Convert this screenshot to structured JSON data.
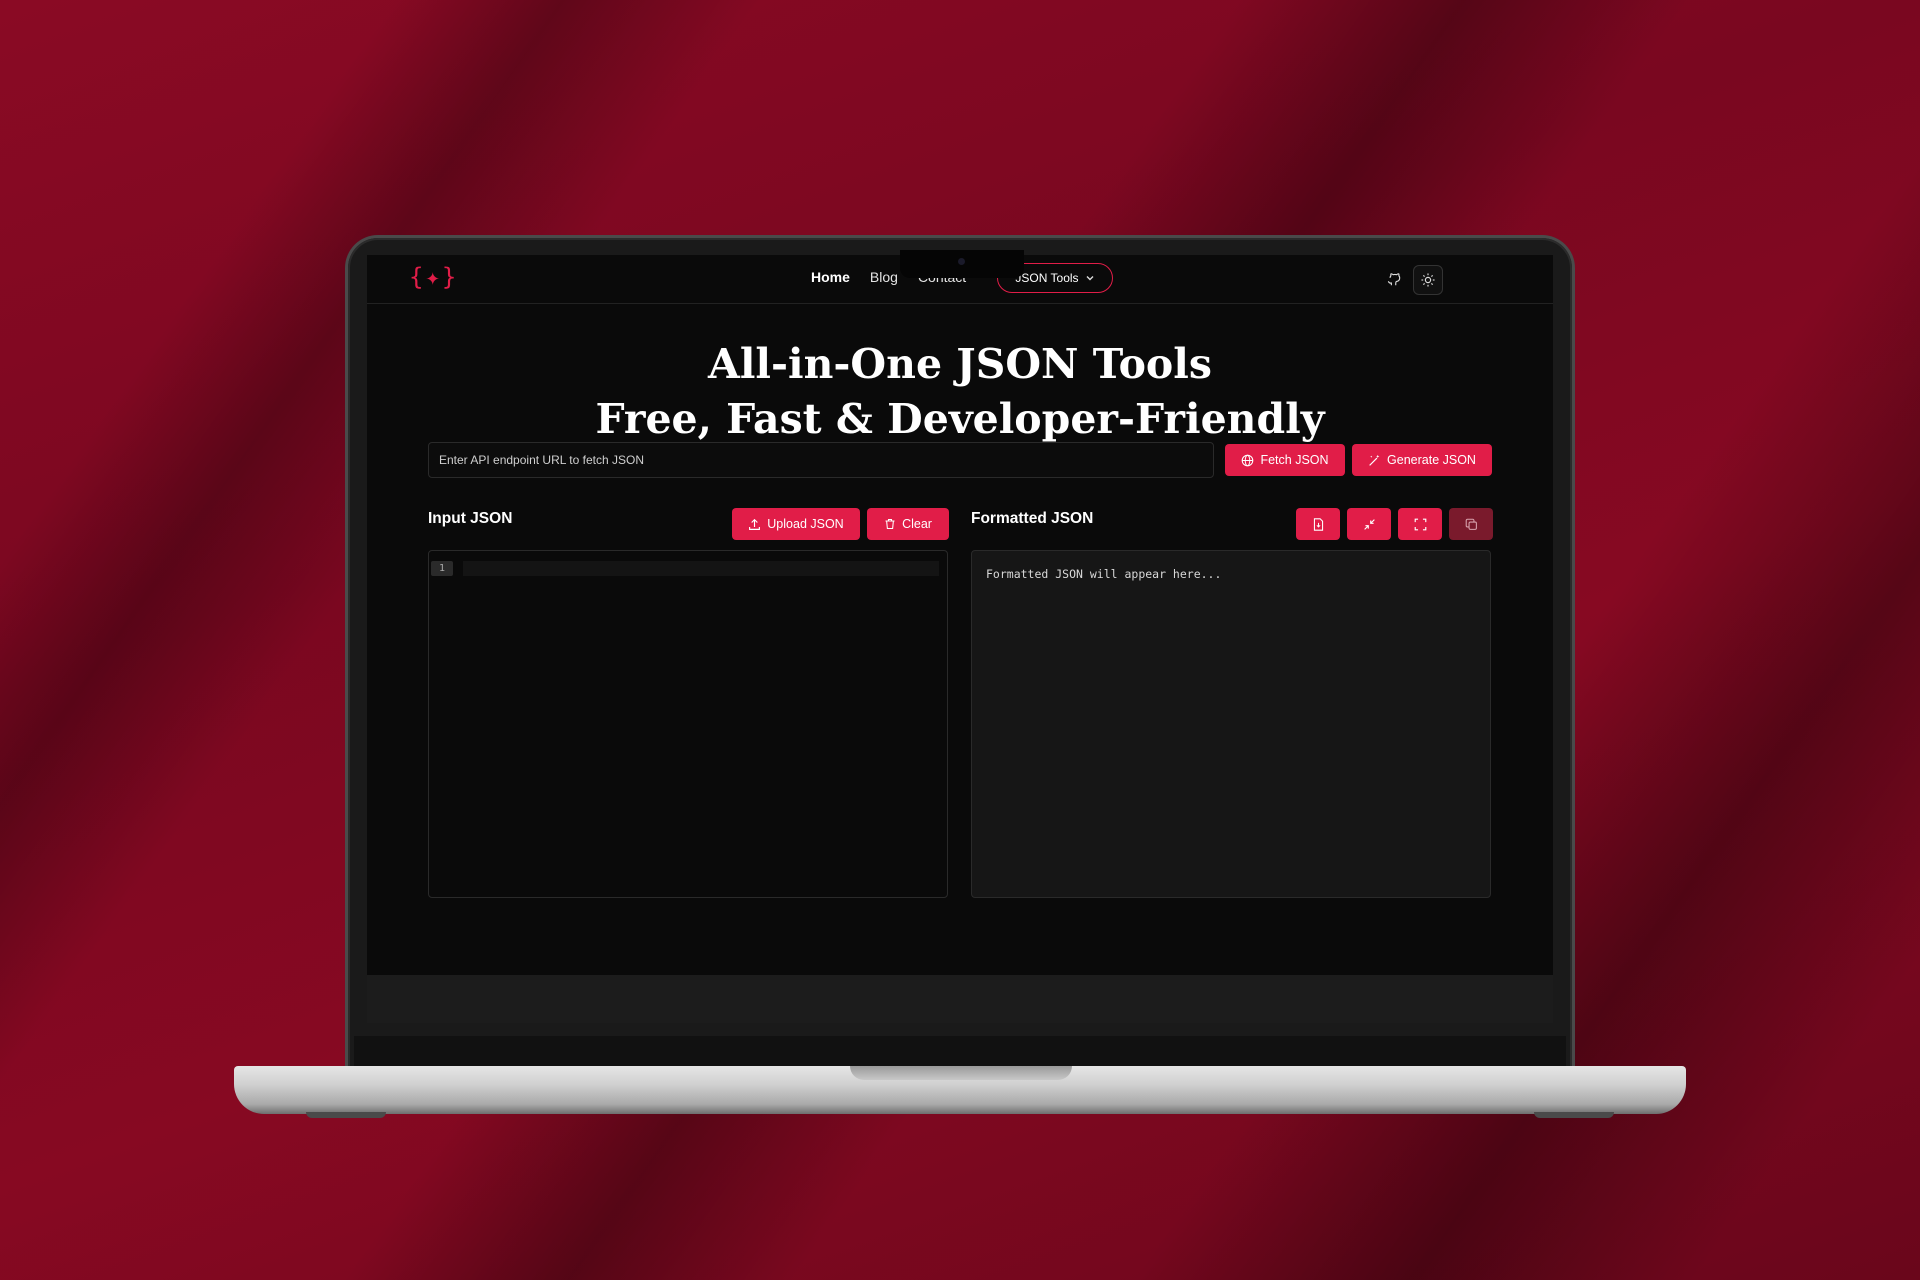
{
  "app": {
    "logo": "{✦}",
    "nav": {
      "home": "Home",
      "blog": "Blog",
      "contact": "Contact",
      "tools_dropdown": "JSON Tools"
    },
    "hero": {
      "line1": "All-in-One JSON Tools",
      "line2": "Free, Fast & Developer-Friendly"
    },
    "fetch": {
      "placeholder": "Enter API endpoint URL to fetch JSON",
      "fetch_label": "Fetch JSON",
      "generate_label": "Generate JSON"
    },
    "input": {
      "title": "Input JSON",
      "upload_label": "Upload JSON",
      "clear_label": "Clear",
      "line_number": "1"
    },
    "output": {
      "title": "Formatted JSON",
      "placeholder": "Formatted JSON will appear here..."
    },
    "icons": {
      "github": "github-icon",
      "theme": "sun-icon",
      "download": "file-download-icon",
      "minify": "minimize-icon",
      "fullscreen": "fullscreen-icon",
      "copy": "copy-icon"
    }
  },
  "colors": {
    "accent": "#e11d48",
    "background": "#0a0a0a",
    "backdrop": "#7a0720"
  }
}
